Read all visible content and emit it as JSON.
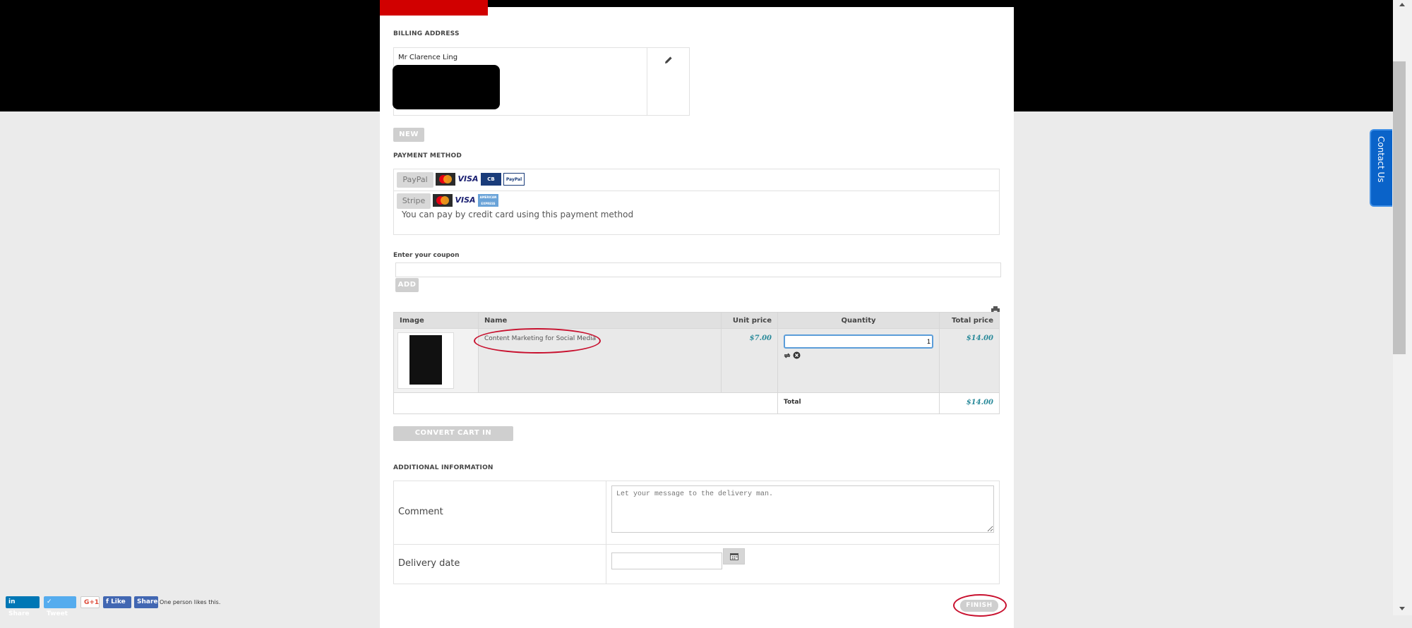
{
  "billing": {
    "title": "BILLING ADDRESS",
    "name": "Mr Clarence Ling",
    "new_label": "NEW"
  },
  "payment": {
    "title": "PAYMENT METHOD",
    "paypal_label": "PayPal",
    "stripe_label": "Stripe",
    "stripe_description": "You can pay by credit card using this payment method",
    "card_labels": {
      "mastercard": "MasterCard",
      "visa": "VISA",
      "cb": "CB",
      "paypal": "PayPal",
      "amex": "AMERICAN EXPRESS"
    }
  },
  "coupon": {
    "label": "Enter your coupon",
    "value": "",
    "add_label": "ADD"
  },
  "cart": {
    "headers": {
      "image": "Image",
      "name": "Name",
      "unit_price": "Unit price",
      "quantity": "Quantity",
      "total_price": "Total price"
    },
    "item": {
      "name": "Content Marketing for Social Media",
      "unit_price": "$7.00",
      "quantity": "1",
      "total_price": "$14.00"
    },
    "total_label": "Total",
    "total_value": "$14.00",
    "wishlist_label": "CONVERT CART IN WISHLIST"
  },
  "additional": {
    "title": "ADDITIONAL INFORMATION",
    "comment_label": "Comment",
    "comment_placeholder": "Let your message to the delivery man.",
    "delivery_label": "Delivery date",
    "delivery_value": ""
  },
  "finish_label": "FINISH",
  "contact_label": "Contact Us",
  "social": {
    "linkedin": "Share",
    "tweet": "Tweet",
    "gplus": "G+1",
    "fb_like": "Like",
    "fb_share": "Share",
    "likes_text": "One person likes this."
  },
  "colors": {
    "accent_red": "#d10000",
    "price_teal": "#2a8a9a",
    "contact_blue": "#0a63c9"
  }
}
